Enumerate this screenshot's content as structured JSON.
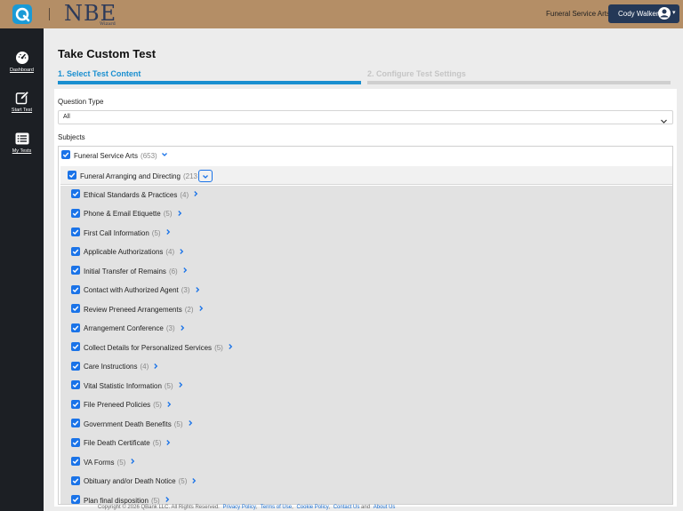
{
  "header": {
    "nbe_logo": "NBE",
    "nbe_logo_sub": "Wizard",
    "subject": "Funeral Service Arts",
    "user_name": "Cody Walker"
  },
  "sidebar": {
    "items": [
      {
        "label": "Dashboard",
        "icon": "dashboard-icon"
      },
      {
        "label": "Start Test",
        "icon": "edit-icon"
      },
      {
        "label": "My Tests",
        "icon": "list-icon"
      }
    ]
  },
  "main": {
    "title": "Take Custom Test",
    "steps": [
      {
        "label": "1. Select Test Content",
        "active": true
      },
      {
        "label": "2. Configure Test Settings",
        "active": false
      }
    ],
    "question_type_label": "Question Type",
    "question_type_value": "All",
    "subjects_label": "Subjects",
    "root": {
      "label": "Funeral Service Arts",
      "count": "(653)"
    },
    "category": {
      "label": "Funeral Arranging and Directing",
      "count": "(213"
    },
    "topics": [
      {
        "label": "Ethical Standards & Practices",
        "count": "(4)"
      },
      {
        "label": "Phone & Email Etiquette",
        "count": "(5)"
      },
      {
        "label": "First Call Information",
        "count": "(5)"
      },
      {
        "label": "Applicable Authorizations",
        "count": "(4)"
      },
      {
        "label": "Initial Transfer of Remains",
        "count": "(6)"
      },
      {
        "label": "Contact with Authorized Agent",
        "count": "(3)"
      },
      {
        "label": "Review Preneed Arrangements",
        "count": "(2)"
      },
      {
        "label": "Arrangement Conference",
        "count": "(3)"
      },
      {
        "label": "Collect Details for Personalized Services",
        "count": "(5)"
      },
      {
        "label": "Care Instructions",
        "count": "(4)"
      },
      {
        "label": "Vital Statistic Information",
        "count": "(5)"
      },
      {
        "label": "File Preneed Policies",
        "count": "(5)"
      },
      {
        "label": "Government Death Benefits",
        "count": "(5)"
      },
      {
        "label": "File Death Certificate",
        "count": "(5)"
      },
      {
        "label": "VA Forms",
        "count": "(5)"
      },
      {
        "label": "Obituary and/or Death Notice",
        "count": "(5)"
      },
      {
        "label": "Plan final disposition",
        "count": "(5)"
      }
    ]
  },
  "footer": {
    "copyright": "Copyright © 2026 QBank LLC. All Rights Reserved.",
    "links": [
      "Privacy Policy",
      "Terms of Use",
      "Cookie Policy",
      "Contact Us",
      "About Us"
    ],
    "separator": ",",
    "last_separator": "and"
  },
  "colors": {
    "header_bg": "#b48e66",
    "sidebar_bg": "#1c1f24",
    "accent": "#1a8fd0",
    "checkbox": "#1a73e8",
    "user_button": "#243857"
  }
}
